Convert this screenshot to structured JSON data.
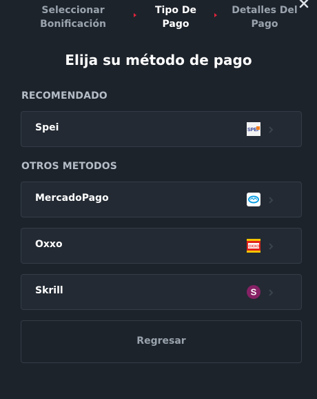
{
  "stepper": {
    "steps": [
      {
        "line1": "Seleccionar",
        "line2": "Bonificación",
        "state": "inactive"
      },
      {
        "line1": "Tipo De",
        "line2": "Pago",
        "state": "active"
      },
      {
        "line1": "Detalles Del",
        "line2": "Pago",
        "state": "inactive"
      }
    ],
    "arrow_color": "#e0243a",
    "close_icon": "close-icon"
  },
  "title": "Elija su método de pago",
  "sections": {
    "recommended_label": "RECOMENDADO",
    "others_label": "OTROS METODOS"
  },
  "methods": {
    "spei": {
      "label": "Spei",
      "logo_icon": "spei-logo-icon",
      "logo_text": "SPEI"
    },
    "mercadopago": {
      "label": "MercadoPago",
      "logo_icon": "mercadopago-logo-icon"
    },
    "oxxo": {
      "label": "Oxxo",
      "logo_icon": "oxxo-logo-icon",
      "logo_text": "OXXO"
    },
    "skrill": {
      "label": "Skrill",
      "logo_icon": "skrill-logo-icon",
      "logo_text": "S"
    }
  },
  "back_button": {
    "label": "Regresar"
  },
  "colors": {
    "background": "#1d232b",
    "card": "#232a33",
    "card_border": "#343c47",
    "accent": "#e0243a",
    "muted_text": "#9aa3ad",
    "section_text": "#b4bcc6"
  }
}
